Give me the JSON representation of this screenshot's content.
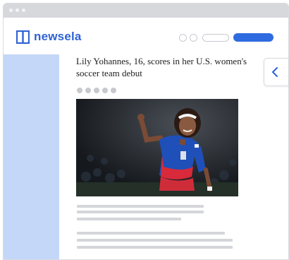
{
  "app": {
    "name": "newsela"
  },
  "article": {
    "headline": "Lily Yohannes, 16, scores in her U.S. women's soccer team debut"
  },
  "colors": {
    "brand": "#2f63d4",
    "sidebar": "#c4d7f9",
    "primary_button": "#2f6be0"
  },
  "icons": {
    "logo": "newsela-book-icon",
    "back": "chevron-left-icon"
  }
}
